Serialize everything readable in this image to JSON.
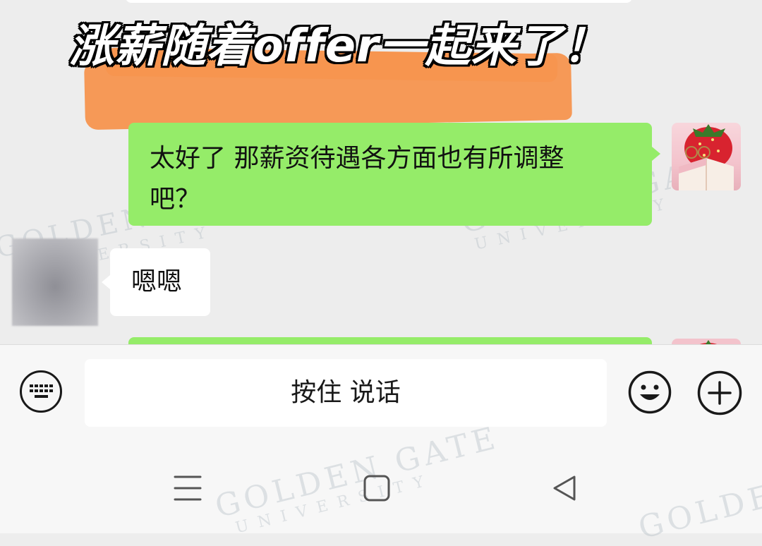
{
  "headline": "涨薪随着offer一起来了！",
  "messages": [
    {
      "sender": "me",
      "text_line1": "太好了 那薪资待遇各方面也有所调整",
      "text_line2": "吧？"
    },
    {
      "sender": "other",
      "text": "嗯嗯"
    },
    {
      "sender": "me",
      "text": ""
    }
  ],
  "watermark": {
    "line1": "GOLDEN GATE",
    "line2": "UNIVERSITY"
  },
  "input_bar": {
    "voice_label": "按住 说话",
    "keyboard_icon": "keyboard-icon",
    "emoji_icon": "smiley-icon",
    "more_icon": "plus-icon"
  },
  "nav": {
    "menu_icon": "menu-icon",
    "home_icon": "home-icon",
    "back_icon": "back-icon"
  },
  "colors": {
    "chat_bg": "#ededed",
    "my_bubble": "#95ec69",
    "other_bubble": "#ffffff",
    "highlight": "#f7954f"
  }
}
